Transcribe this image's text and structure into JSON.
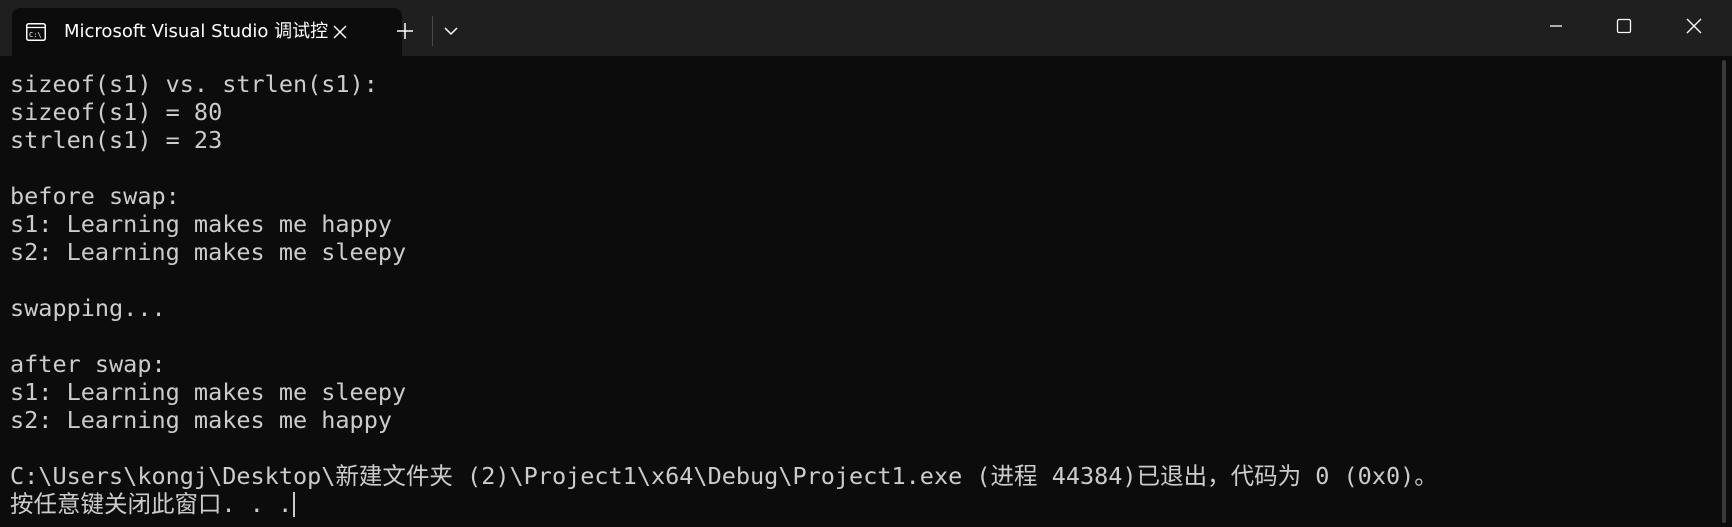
{
  "window": {
    "tab_title": "Microsoft Visual Studio 调试控",
    "tab_icon": "console-icon",
    "controls": {
      "new_tab": "plus-icon",
      "dropdown": "chevron-down-icon",
      "minimize": "minimize-icon",
      "maximize": "maximize-icon",
      "close": "close-icon"
    }
  },
  "console": {
    "lines": [
      "sizeof(s1) vs. strlen(s1):",
      "sizeof(s1) = 80",
      "strlen(s1) = 23",
      "",
      "before swap:",
      "s1: Learning makes me happy",
      "s2: Learning makes me sleepy",
      "",
      "swapping...",
      "",
      "after swap:",
      "s1: Learning makes me sleepy",
      "s2: Learning makes me happy",
      "",
      "C:\\Users\\kongj\\Desktop\\新建文件夹 (2)\\Project1\\x64\\Debug\\Project1.exe (进程 44384)已退出，代码为 0 (0x0)。",
      "按任意键关闭此窗口. . ."
    ]
  },
  "colors": {
    "background": "#0c0c0c",
    "titlebar": "#1f1f1f",
    "text": "#cccccc"
  }
}
